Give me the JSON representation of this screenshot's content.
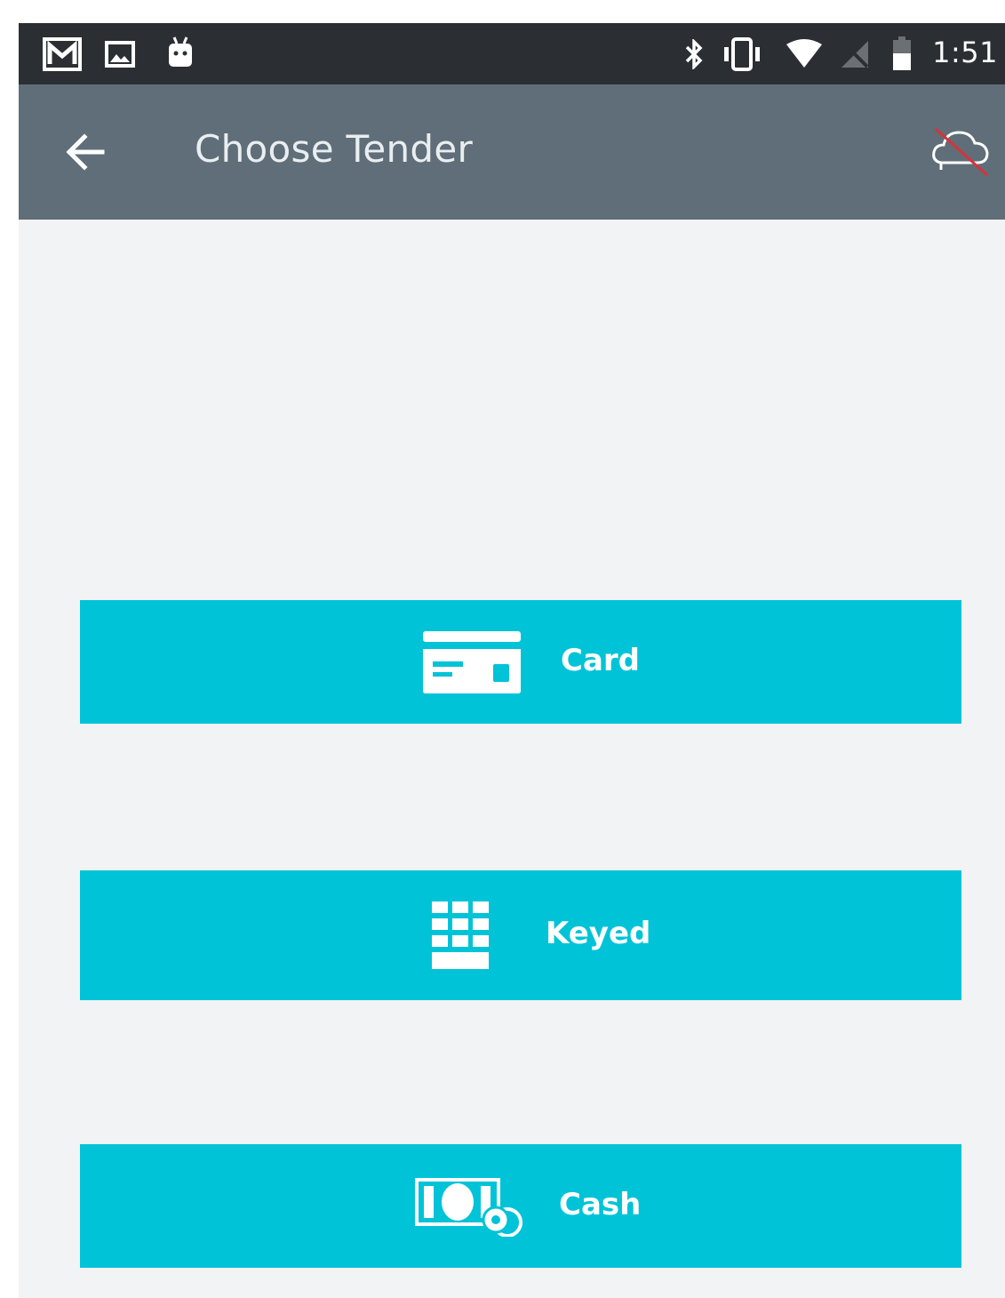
{
  "status_bar": {
    "time": "1:51",
    "left_icons": [
      "gmail-icon",
      "image-icon",
      "android-icon"
    ],
    "right_icons": [
      "bluetooth-icon",
      "vibrate-icon",
      "wifi-icon",
      "no-signal-icon",
      "battery-icon"
    ]
  },
  "app_bar": {
    "title": "Choose Tender",
    "back_icon": "arrow-left-icon",
    "action_icon": "cloud-offline-icon"
  },
  "tenders": {
    "card_label": "Card",
    "keyed_label": "Keyed",
    "cash_label": "Cash"
  },
  "colors": {
    "accent": "#00c3d8",
    "app_bar": "#5f6e78",
    "status_bar": "#2b2f33",
    "background": "#f1f3f4",
    "offline_strike": "#d9323a"
  }
}
